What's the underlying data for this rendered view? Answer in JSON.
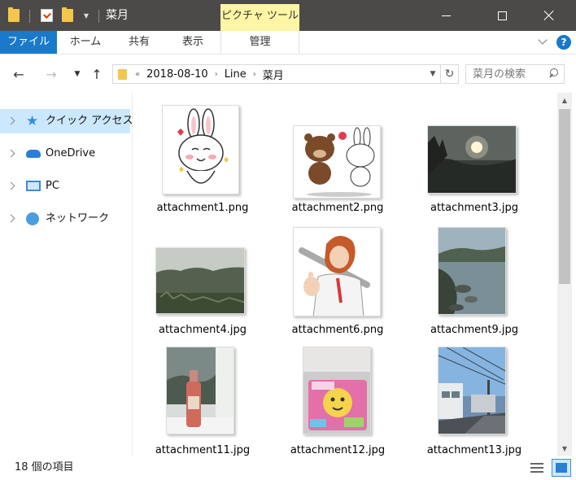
{
  "window": {
    "title": "菜月",
    "contextual_tab_header": "ピクチャ ツール"
  },
  "ribbon": {
    "tabs": [
      "ファイル",
      "ホーム",
      "共有",
      "表示",
      "管理"
    ],
    "help": "?"
  },
  "address": {
    "overflow": "«",
    "crumbs": [
      "2018-08-10",
      "Line",
      "菜月"
    ]
  },
  "search": {
    "placeholder": "菜月の検索"
  },
  "navpane": {
    "items": [
      {
        "label": "クイック アクセス",
        "icon": "star-icon",
        "selected": true
      },
      {
        "label": "OneDrive",
        "icon": "cloud-icon",
        "selected": false
      },
      {
        "label": "PC",
        "icon": "pc-icon",
        "selected": false
      },
      {
        "label": "ネットワーク",
        "icon": "network-icon",
        "selected": false
      }
    ]
  },
  "files": [
    {
      "name": "attachment1.png"
    },
    {
      "name": "attachment2.png"
    },
    {
      "name": "attachment3.jpg"
    },
    {
      "name": "attachment4.jpg"
    },
    {
      "name": "attachment6.png"
    },
    {
      "name": "attachment9.jpg"
    },
    {
      "name": "attachment11.jpg"
    },
    {
      "name": "attachment12.jpg"
    },
    {
      "name": "attachment13.jpg"
    }
  ],
  "status": {
    "item_count": "18 個の項目"
  },
  "colors": {
    "accent": "#1979ca",
    "titlebar": "#4c4a48",
    "contextual_tab": "#fff5a5",
    "selection": "#cce8ff"
  }
}
